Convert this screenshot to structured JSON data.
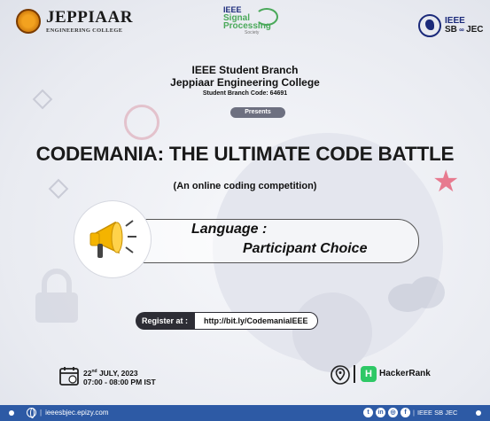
{
  "header": {
    "left_logo": {
      "name": "JEPPIAAR",
      "subtitle": "ENGINEERING COLLEGE"
    },
    "center_logo": {
      "org": "IEEE",
      "line1": "Signal",
      "line2": "Processing",
      "line3": "Society"
    },
    "right_logo": {
      "line1": "IEEE",
      "line2": "SB",
      "line3": "JEC"
    }
  },
  "intro": {
    "branch": "IEEE Student Branch",
    "college": "Jeppiaar Engineering College",
    "code": "Student Branch Code: 64691",
    "presents": "Presents"
  },
  "event": {
    "title": "CODEMANIA: THE ULTIMATE CODE BATTLE",
    "subtitle": "(An online coding competition)"
  },
  "language": {
    "label": "Language :",
    "value": "Participant Choice",
    "icon": "megaphone-icon"
  },
  "register": {
    "label": "Register at :",
    "link": "http://bit.ly/CodemaniaIEEE"
  },
  "schedule": {
    "date_day": "22",
    "date_suffix": "nd",
    "date_rest": " JULY, 2023",
    "time": "07:00 - 08:00 PM IST",
    "icon": "calendar-icon"
  },
  "venue": {
    "platform": "HackerRank",
    "badge": "H",
    "icon": "location-pin-icon"
  },
  "footer": {
    "website": "ieeesbjec.epizy.com",
    "social_handle": "IEEE SB JEC",
    "social_icons": [
      "f",
      "in",
      "ig",
      "fb"
    ]
  },
  "colors": {
    "footer_bg": "#2d5aa5",
    "hackerrank_green": "#2ec866",
    "megaphone_yellow": "#f4b400"
  }
}
